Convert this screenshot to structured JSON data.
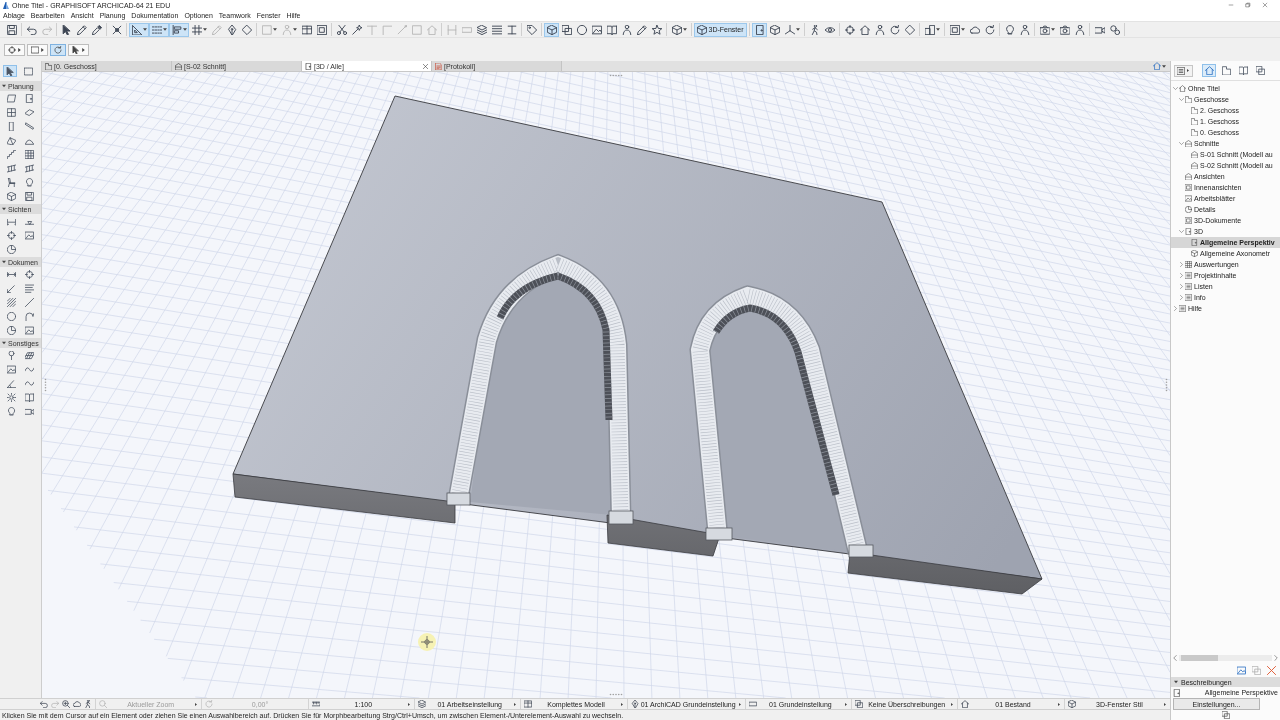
{
  "window": {
    "title": "Ohne Titel - GRAPHISOFT ARCHICAD-64 21 EDU"
  },
  "menu": [
    "Ablage",
    "Bearbeiten",
    "Ansicht",
    "Planung",
    "Dokumentation",
    "Optionen",
    "Teamwork",
    "Fenster",
    "Hilfe"
  ],
  "toolbar": {
    "groups": [
      [
        {
          "kind": "button",
          "selected": false,
          "disabled": false
        }
      ],
      [
        {
          "kind": "button",
          "selected": false,
          "disabled": false
        },
        {
          "kind": "button",
          "selected": false,
          "disabled": true
        }
      ],
      [
        {
          "kind": "button",
          "selected": false,
          "disabled": false
        },
        {
          "kind": "button",
          "selected": false,
          "disabled": false
        },
        {
          "kind": "button",
          "selected": false,
          "disabled": false
        }
      ],
      [
        {
          "kind": "button",
          "selected": false,
          "disabled": false
        }
      ],
      [
        {
          "kind": "dropdown",
          "selected": true,
          "disabled": false
        },
        {
          "kind": "dropdown",
          "selected": true,
          "disabled": false
        },
        {
          "kind": "dropdown",
          "selected": true,
          "disabled": false
        },
        {
          "kind": "dropdown",
          "selected": false,
          "disabled": false
        },
        {
          "kind": "button",
          "selected": false,
          "disabled": true
        },
        {
          "kind": "button",
          "selected": false,
          "disabled": false
        },
        {
          "kind": "button",
          "selected": false,
          "disabled": false
        }
      ],
      [
        {
          "kind": "dropdown",
          "selected": false,
          "disabled": true
        },
        {
          "kind": "dropdown",
          "selected": false,
          "disabled": true
        },
        {
          "kind": "button",
          "selected": false,
          "disabled": false
        },
        {
          "kind": "button",
          "selected": false,
          "disabled": false
        }
      ],
      [
        {
          "kind": "button",
          "selected": false,
          "disabled": false
        },
        {
          "kind": "button",
          "selected": false,
          "disabled": false
        },
        {
          "kind": "button",
          "selected": false,
          "disabled": true
        },
        {
          "kind": "button",
          "selected": false,
          "disabled": true
        },
        {
          "kind": "button",
          "selected": false,
          "disabled": true
        },
        {
          "kind": "button",
          "selected": false,
          "disabled": true
        },
        {
          "kind": "button",
          "selected": false,
          "disabled": true
        }
      ],
      [
        {
          "kind": "button",
          "selected": false,
          "disabled": true
        },
        {
          "kind": "button",
          "selected": false,
          "disabled": true
        },
        {
          "kind": "button",
          "selected": false,
          "disabled": false
        },
        {
          "kind": "button",
          "selected": false,
          "disabled": false
        },
        {
          "kind": "button",
          "selected": false,
          "disabled": false
        }
      ],
      [
        {
          "kind": "button",
          "selected": false,
          "disabled": false
        }
      ],
      [
        {
          "kind": "button",
          "selected": true,
          "disabled": false
        },
        {
          "kind": "button",
          "selected": false,
          "disabled": false
        },
        {
          "kind": "button",
          "selected": false,
          "disabled": false
        },
        {
          "kind": "button",
          "selected": false,
          "disabled": false
        },
        {
          "kind": "button",
          "selected": false,
          "disabled": false
        },
        {
          "kind": "button",
          "selected": false,
          "disabled": false
        },
        {
          "kind": "button",
          "selected": false,
          "disabled": false
        },
        {
          "kind": "button",
          "selected": false,
          "disabled": false
        }
      ],
      [
        {
          "kind": "dropdown",
          "selected": false,
          "disabled": false
        }
      ],
      [
        {
          "kind": "labeled",
          "label": "3D-Fenster",
          "selected": true,
          "disabled": false
        }
      ],
      [
        {
          "kind": "button",
          "selected": true,
          "disabled": false
        },
        {
          "kind": "button",
          "selected": false,
          "disabled": false
        },
        {
          "kind": "dropdown",
          "selected": false,
          "disabled": false
        }
      ],
      [
        {
          "kind": "button",
          "selected": false,
          "disabled": false
        },
        {
          "kind": "button",
          "selected": false,
          "disabled": false
        }
      ],
      [
        {
          "kind": "button",
          "selected": false,
          "disabled": false
        },
        {
          "kind": "button",
          "selected": false,
          "disabled": false
        },
        {
          "kind": "button",
          "selected": false,
          "disabled": false
        },
        {
          "kind": "button",
          "selected": false,
          "disabled": false
        },
        {
          "kind": "button",
          "selected": false,
          "disabled": false
        }
      ],
      [
        {
          "kind": "dropdown",
          "selected": false,
          "disabled": false
        }
      ],
      [
        {
          "kind": "dropdown",
          "selected": false,
          "disabled": false
        },
        {
          "kind": "button",
          "selected": false,
          "disabled": false
        },
        {
          "kind": "button",
          "selected": false,
          "disabled": false
        }
      ],
      [
        {
          "kind": "button",
          "selected": false,
          "disabled": false
        },
        {
          "kind": "button",
          "selected": false,
          "disabled": false
        }
      ],
      [
        {
          "kind": "dropdown",
          "selected": false,
          "disabled": false
        },
        {
          "kind": "button",
          "selected": false,
          "disabled": false
        },
        {
          "kind": "button",
          "selected": false,
          "disabled": false
        }
      ],
      [
        {
          "kind": "button",
          "selected": false,
          "disabled": false
        },
        {
          "kind": "button",
          "selected": false,
          "disabled": false
        }
      ]
    ]
  },
  "toolbar2": [
    {
      "kind": "dropdown",
      "selected": false
    },
    {
      "kind": "dropdown",
      "selected": false
    },
    {
      "kind": "button",
      "selected": true
    },
    {
      "kind": "dropdown",
      "selected": false
    }
  ],
  "toolbox": {
    "pointer_tools": [
      {
        "selected": true
      },
      {
        "selected": false
      }
    ],
    "sections": [
      {
        "title": "Planung",
        "expanded": true,
        "tools": [
          {
            "selected": false
          },
          {
            "selected": false
          },
          {
            "selected": false
          },
          {
            "selected": false
          },
          {
            "selected": false
          },
          {
            "selected": false
          },
          {
            "selected": false
          },
          {
            "selected": false
          },
          {
            "selected": false
          },
          {
            "selected": false
          },
          {
            "selected": false
          },
          {
            "selected": false
          },
          {
            "selected": false
          },
          {
            "selected": false
          },
          {
            "selected": false
          },
          {
            "selected": false
          }
        ]
      },
      {
        "title": "Sichten",
        "expanded": true,
        "tools": [
          {
            "selected": false
          },
          {
            "selected": false
          },
          {
            "selected": false
          },
          {
            "selected": false
          },
          {
            "selected": false
          }
        ]
      },
      {
        "title": "Dokumen",
        "expanded": true,
        "tools": [
          {
            "selected": false
          },
          {
            "selected": false
          },
          {
            "selected": false
          },
          {
            "selected": false
          },
          {
            "selected": false
          },
          {
            "selected": false
          },
          {
            "selected": false
          },
          {
            "selected": false
          },
          {
            "selected": false
          },
          {
            "selected": false
          }
        ]
      },
      {
        "title": "Sonstiges",
        "expanded": true,
        "tools": [
          {
            "selected": false
          },
          {
            "selected": false
          },
          {
            "selected": false
          },
          {
            "selected": false
          },
          {
            "selected": false
          },
          {
            "selected": false
          },
          {
            "selected": false
          },
          {
            "selected": false
          },
          {
            "selected": false
          },
          {
            "selected": false
          }
        ]
      }
    ]
  },
  "tabs": [
    {
      "kind": "floor-plan",
      "label": "[0. Geschoss]",
      "selected": false
    },
    {
      "kind": "section",
      "label": "[S-02 Schnitt]",
      "selected": false
    },
    {
      "kind": "model",
      "label": "[3D / Alle]",
      "selected": true
    },
    {
      "kind": "report",
      "label": "[Protokoll]",
      "selected": false
    }
  ],
  "navigator": {
    "tabs": [
      {
        "selected": true
      },
      {
        "selected": false
      },
      {
        "selected": false
      },
      {
        "selected": false
      }
    ],
    "tree": [
      {
        "kind": "project",
        "label": "Ohne Titel",
        "selected": false,
        "expanded": true,
        "children": [
          {
            "kind": "stories",
            "label": "Geschosse",
            "selected": false,
            "expanded": true,
            "children": [
              {
                "kind": "story",
                "label": "2. Geschoss",
                "selected": false
              },
              {
                "kind": "story",
                "label": "1. Geschoss",
                "selected": false
              },
              {
                "kind": "story",
                "label": "0. Geschoss",
                "selected": false
              }
            ]
          },
          {
            "kind": "sections",
            "label": "Schnitte",
            "selected": false,
            "expanded": true,
            "children": [
              {
                "kind": "section",
                "label": "S-01 Schnitt (Modell au",
                "selected": false
              },
              {
                "kind": "section",
                "label": "S-02 Schnitt (Modell au",
                "selected": false
              }
            ]
          },
          {
            "kind": "section",
            "label": "Ansichten",
            "selected": false
          },
          {
            "kind": "interior",
            "label": "Innenansichten",
            "selected": false
          },
          {
            "kind": "worksheet",
            "label": "Arbeitsblätter",
            "selected": false
          },
          {
            "kind": "detail",
            "label": "Details",
            "selected": false
          },
          {
            "kind": "document",
            "label": "3D-Dokumente",
            "selected": false
          },
          {
            "kind": "model",
            "label": "3D",
            "selected": false,
            "expanded": true,
            "children": [
              {
                "kind": "perspective",
                "label": "Allgemeine Perspektiv",
                "selected": true
              },
              {
                "kind": "axonometry",
                "label": "Allgemeine Axonometr",
                "selected": false
              }
            ]
          },
          {
            "kind": "schedule",
            "label": "Auswertungen",
            "selected": false,
            "expanded": false
          },
          {
            "kind": "folder",
            "label": "Projektinhalte",
            "selected": false,
            "expanded": false
          },
          {
            "kind": "list",
            "label": "Listen",
            "selected": false,
            "expanded": false
          },
          {
            "kind": "folder",
            "label": "Info",
            "selected": false,
            "expanded": false
          }
        ]
      },
      {
        "kind": "folder",
        "label": "Hilfe",
        "selected": false,
        "expanded": false
      }
    ],
    "description": {
      "title": "Beschreibungen",
      "expanded": true,
      "text": "Allgemeine Perspektive"
    },
    "settings_button": "Einstellungen..."
  },
  "status_bar": {
    "tools": [
      {
        "disabled": false
      },
      {
        "disabled": true
      },
      {
        "disabled": false
      },
      {
        "disabled": false
      },
      {
        "disabled": false
      }
    ],
    "quick_options": [
      {
        "kind": "zoom",
        "label": "Aktueller Zoom",
        "disabled": true
      },
      {
        "kind": "rotation",
        "label": "0,00°",
        "disabled": true
      },
      {
        "kind": "scale",
        "label": "1:100",
        "disabled": false
      },
      {
        "kind": "layers",
        "label": "01 Arbeitseinstellung",
        "disabled": false
      },
      {
        "kind": "model-view",
        "label": "Komplettes Modell",
        "disabled": false
      },
      {
        "kind": "pen-set",
        "label": "01 ArchiCAD Grundeinstellung",
        "disabled": false
      },
      {
        "kind": "dimension",
        "label": "01 Grundeinstellung",
        "disabled": false
      },
      {
        "kind": "override",
        "label": "Keine Überschreibungen",
        "disabled": false
      },
      {
        "kind": "renovation",
        "label": "01 Bestand",
        "disabled": false
      },
      {
        "kind": "style",
        "label": "3D-Fenster Stil",
        "disabled": false
      }
    ],
    "message": "Klicken Sie mit dem Cursor auf ein Element oder ziehen Sie einen Auswahlbereich auf. Drücken Sie für Morphbearbeitung Strg/Ctrl+Umsch, um zwischen Element-/Unterelement-Auswahl zu wechseln."
  }
}
